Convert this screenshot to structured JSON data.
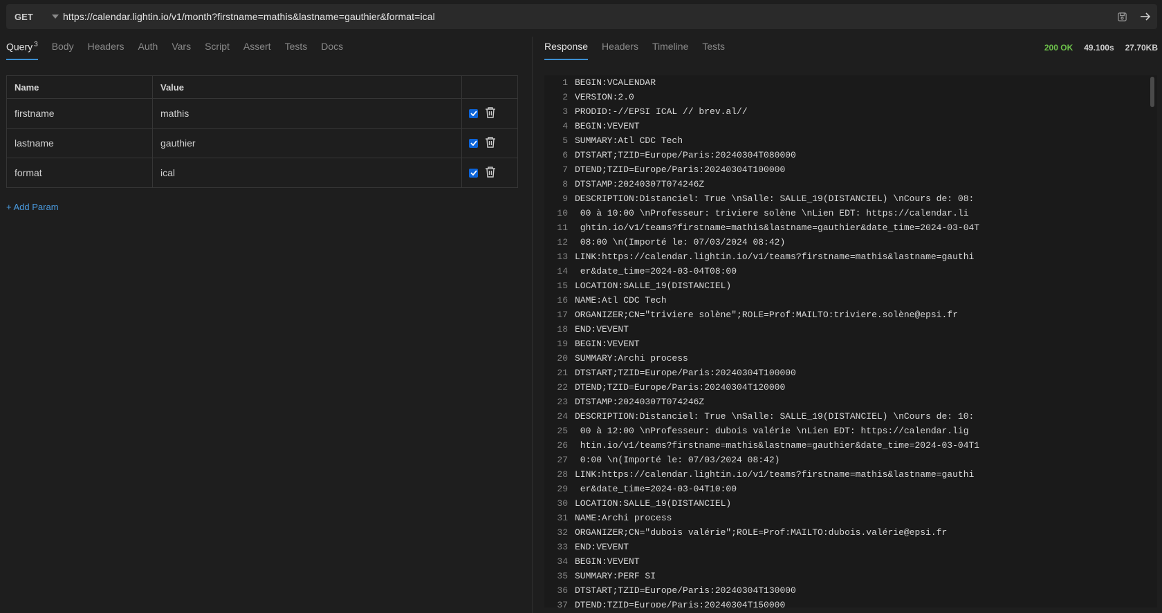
{
  "request": {
    "method": "GET",
    "url": "https://calendar.lightin.io/v1/month?firstname=mathis&lastname=gauthier&format=ical"
  },
  "request_tabs": [
    {
      "label": "Query",
      "badge": "3"
    },
    {
      "label": "Body"
    },
    {
      "label": "Headers"
    },
    {
      "label": "Auth"
    },
    {
      "label": "Vars"
    },
    {
      "label": "Script"
    },
    {
      "label": "Assert"
    },
    {
      "label": "Tests"
    },
    {
      "label": "Docs"
    }
  ],
  "params_table": {
    "header_name": "Name",
    "header_value": "Value",
    "rows": [
      {
        "name": "firstname",
        "value": "mathis",
        "enabled": true
      },
      {
        "name": "lastname",
        "value": "gauthier",
        "enabled": true
      },
      {
        "name": "format",
        "value": "ical",
        "enabled": true
      }
    ],
    "add_label": "+ Add Param"
  },
  "response_tabs": [
    "Response",
    "Headers",
    "Timeline",
    "Tests"
  ],
  "response_status": {
    "code": "200 OK",
    "time": "49.100s",
    "size": "27.70KB"
  },
  "colors": {
    "ok": "#6cc04a",
    "accent": "#3d8fd1",
    "checkbox": "#0b63d8",
    "link": "#4a9be0"
  },
  "icons": {
    "method_dropdown": "caret-down-icon",
    "save": "save-icon",
    "send": "arrow-right-icon",
    "delete": "trash-icon"
  },
  "response_lines": [
    {
      "n": "1",
      "t": "BEGIN:VCALENDAR"
    },
    {
      "n": "2",
      "t": "VERSION:2.0"
    },
    {
      "n": "3",
      "t": "PRODID:-//EPSI ICAL // brev.al//"
    },
    {
      "n": "4",
      "t": "BEGIN:VEVENT"
    },
    {
      "n": "5",
      "t": "SUMMARY:Atl CDC Tech"
    },
    {
      "n": "6",
      "t": "DTSTART;TZID=Europe/Paris:20240304T080000"
    },
    {
      "n": "7",
      "t": "DTEND;TZID=Europe/Paris:20240304T100000"
    },
    {
      "n": "8",
      "t": "DTSTAMP:20240307T074246Z"
    },
    {
      "n": "9",
      "t": "DESCRIPTION:Distanciel: True \\nSalle: SALLE_19(DISTANCIEL) \\nCours de: 08:"
    },
    {
      "n": "10",
      "t": " 00 à 10:00 \\nProfesseur: triviere solène \\nLien EDT: https://calendar.li"
    },
    {
      "n": "11",
      "t": " ghtin.io/v1/teams?firstname=mathis&lastname=gauthier&date_time=2024-03-04T"
    },
    {
      "n": "12",
      "t": " 08:00 \\n(Importé le: 07/03/2024 08:42)"
    },
    {
      "n": "13",
      "t": "LINK:https://calendar.lightin.io/v1/teams?firstname=mathis&lastname=gauthi"
    },
    {
      "n": "14",
      "t": " er&date_time=2024-03-04T08:00"
    },
    {
      "n": "15",
      "t": "LOCATION:SALLE_19(DISTANCIEL)"
    },
    {
      "n": "16",
      "t": "NAME:Atl CDC Tech"
    },
    {
      "n": "17",
      "t": "ORGANIZER;CN=\"triviere solène\";ROLE=Prof:MAILTO:triviere.solène@epsi.fr"
    },
    {
      "n": "18",
      "t": "END:VEVENT"
    },
    {
      "n": "19",
      "t": "BEGIN:VEVENT"
    },
    {
      "n": "20",
      "t": "SUMMARY:Archi process"
    },
    {
      "n": "21",
      "t": "DTSTART;TZID=Europe/Paris:20240304T100000"
    },
    {
      "n": "22",
      "t": "DTEND;TZID=Europe/Paris:20240304T120000"
    },
    {
      "n": "23",
      "t": "DTSTAMP:20240307T074246Z"
    },
    {
      "n": "24",
      "t": "DESCRIPTION:Distanciel: True \\nSalle: SALLE_19(DISTANCIEL) \\nCours de: 10:"
    },
    {
      "n": "25",
      "t": " 00 à 12:00 \\nProfesseur: dubois valérie \\nLien EDT: https://calendar.lig"
    },
    {
      "n": "26",
      "t": " htin.io/v1/teams?firstname=mathis&lastname=gauthier&date_time=2024-03-04T1"
    },
    {
      "n": "27",
      "t": " 0:00 \\n(Importé le: 07/03/2024 08:42)"
    },
    {
      "n": "28",
      "t": "LINK:https://calendar.lightin.io/v1/teams?firstname=mathis&lastname=gauthi"
    },
    {
      "n": "29",
      "t": " er&date_time=2024-03-04T10:00"
    },
    {
      "n": "30",
      "t": "LOCATION:SALLE_19(DISTANCIEL)"
    },
    {
      "n": "31",
      "t": "NAME:Archi process"
    },
    {
      "n": "32",
      "t": "ORGANIZER;CN=\"dubois valérie\";ROLE=Prof:MAILTO:dubois.valérie@epsi.fr"
    },
    {
      "n": "33",
      "t": "END:VEVENT"
    },
    {
      "n": "34",
      "t": "BEGIN:VEVENT"
    },
    {
      "n": "35",
      "t": "SUMMARY:PERF SI"
    },
    {
      "n": "36",
      "t": "DTSTART;TZID=Europe/Paris:20240304T130000"
    },
    {
      "n": "37",
      "t": "DTEND;TZID=Europe/Paris:20240304T150000"
    }
  ]
}
